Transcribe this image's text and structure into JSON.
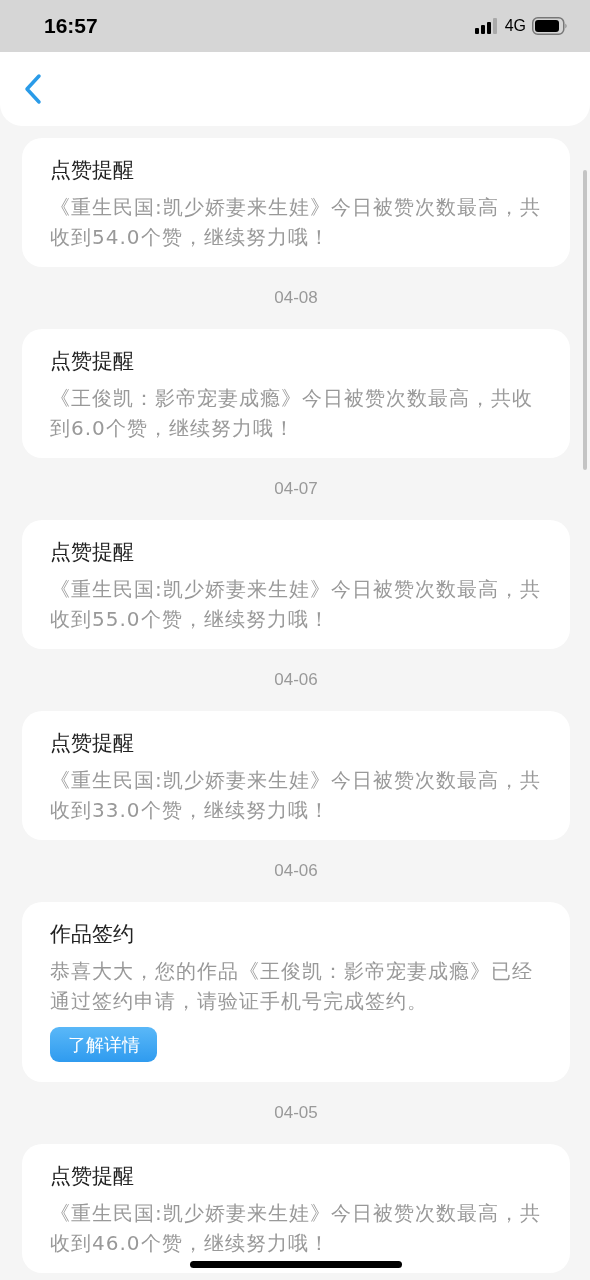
{
  "status_bar": {
    "time": "16:57",
    "network": "4G"
  },
  "feed": [
    {
      "kind": "notice",
      "title": "点赞提醒",
      "body": "《重生民国:凯少娇妻来生娃》今日被赞次数最高，共收到54.0个赞，继续努力哦！"
    },
    {
      "kind": "date",
      "text": "04-08"
    },
    {
      "kind": "notice",
      "title": "点赞提醒",
      "body": "《王俊凯：影帝宠妻成瘾》今日被赞次数最高，共收到6.0个赞，继续努力哦！"
    },
    {
      "kind": "date",
      "text": "04-07"
    },
    {
      "kind": "notice",
      "title": "点赞提醒",
      "body": "《重生民国:凯少娇妻来生娃》今日被赞次数最高，共收到55.0个赞，继续努力哦！"
    },
    {
      "kind": "date",
      "text": "04-06"
    },
    {
      "kind": "notice",
      "title": "点赞提醒",
      "body": "《重生民国:凯少娇妻来生娃》今日被赞次数最高，共收到33.0个赞，继续努力哦！"
    },
    {
      "kind": "date",
      "text": "04-06"
    },
    {
      "kind": "notice",
      "title": "作品签约",
      "body": "恭喜大大，您的作品《王俊凯：影帝宠妻成瘾》已经通过签约申请，请验证手机号完成签约。",
      "button": "了解详情"
    },
    {
      "kind": "date",
      "text": "04-05"
    },
    {
      "kind": "notice",
      "title": "点赞提醒",
      "body": "《重生民国:凯少娇妻来生娃》今日被赞次数最高，共收到46.0个赞，继续努力哦！"
    }
  ]
}
